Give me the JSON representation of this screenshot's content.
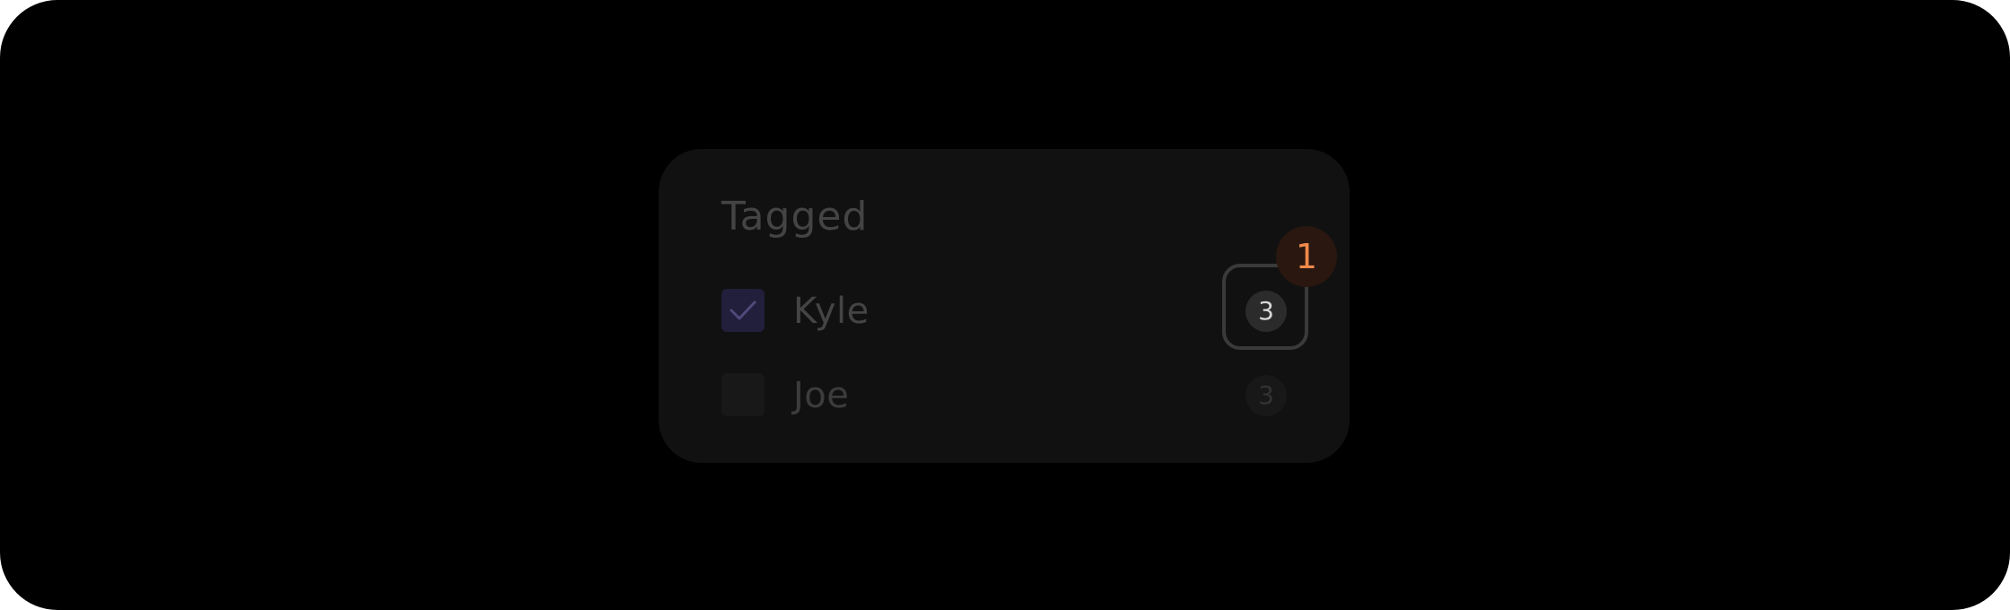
{
  "card": {
    "title": "Tagged",
    "items": [
      {
        "name": "Kyle",
        "checked": true,
        "count": "3"
      },
      {
        "name": "Joe",
        "checked": false,
        "count": "3"
      }
    ]
  },
  "annotation": {
    "step": "1"
  },
  "colors": {
    "background": "#000000",
    "card": "#111111",
    "checked_box": "#221f3c",
    "check_mark": "#4f4a7a",
    "step_badge_bg": "#2a1710",
    "step_badge_text": "#f08a4b"
  },
  "icons": {
    "checkbox_checked": "check-icon"
  }
}
